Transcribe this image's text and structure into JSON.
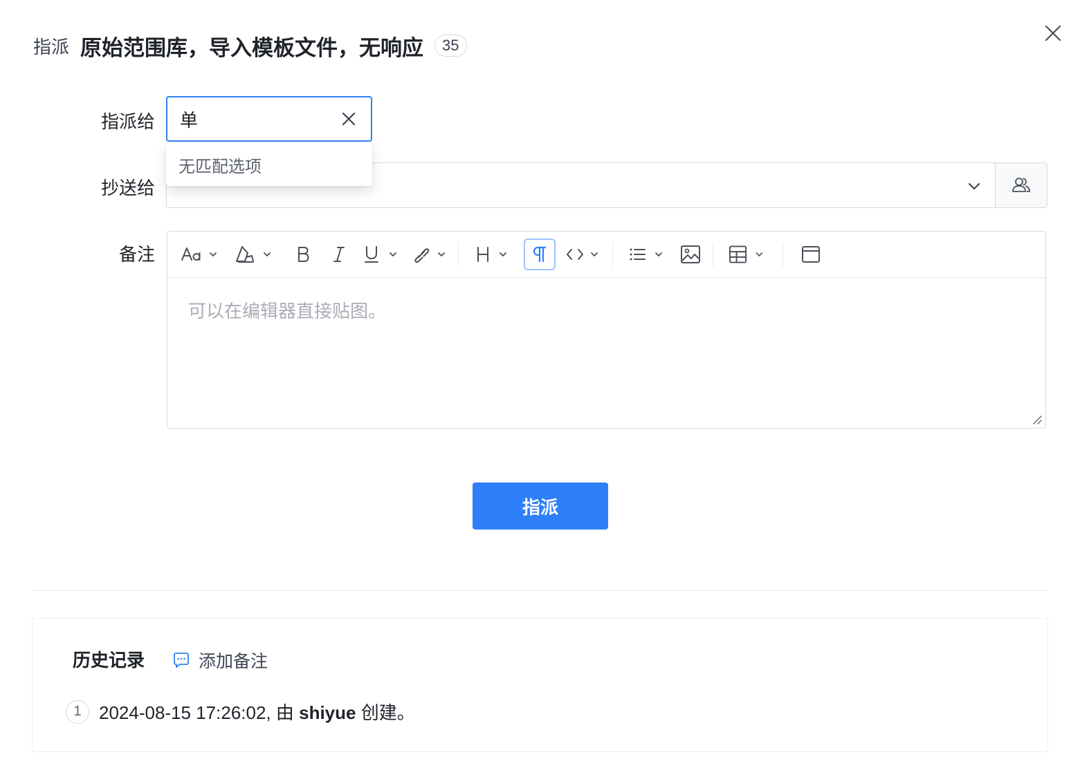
{
  "header": {
    "kind": "指派",
    "title": "原始范围库，导入模板文件，无响应",
    "badge": "35"
  },
  "form": {
    "assign_label": "指派给",
    "assign_value": "单",
    "dropdown_empty": "无匹配选项",
    "cc_label": "抄送给",
    "note_label": "备注",
    "editor_placeholder": "可以在编辑器直接贴图。"
  },
  "submit_label": "指派",
  "history": {
    "title": "历史记录",
    "add_note": "添加备注",
    "items": [
      {
        "index": "1",
        "prefix": "2024-08-15 17:26:02, 由 ",
        "user": "shiyue",
        "suffix": " 创建。"
      }
    ]
  },
  "colors": {
    "primary": "#2e7ff8",
    "border": "#d6dae1"
  }
}
